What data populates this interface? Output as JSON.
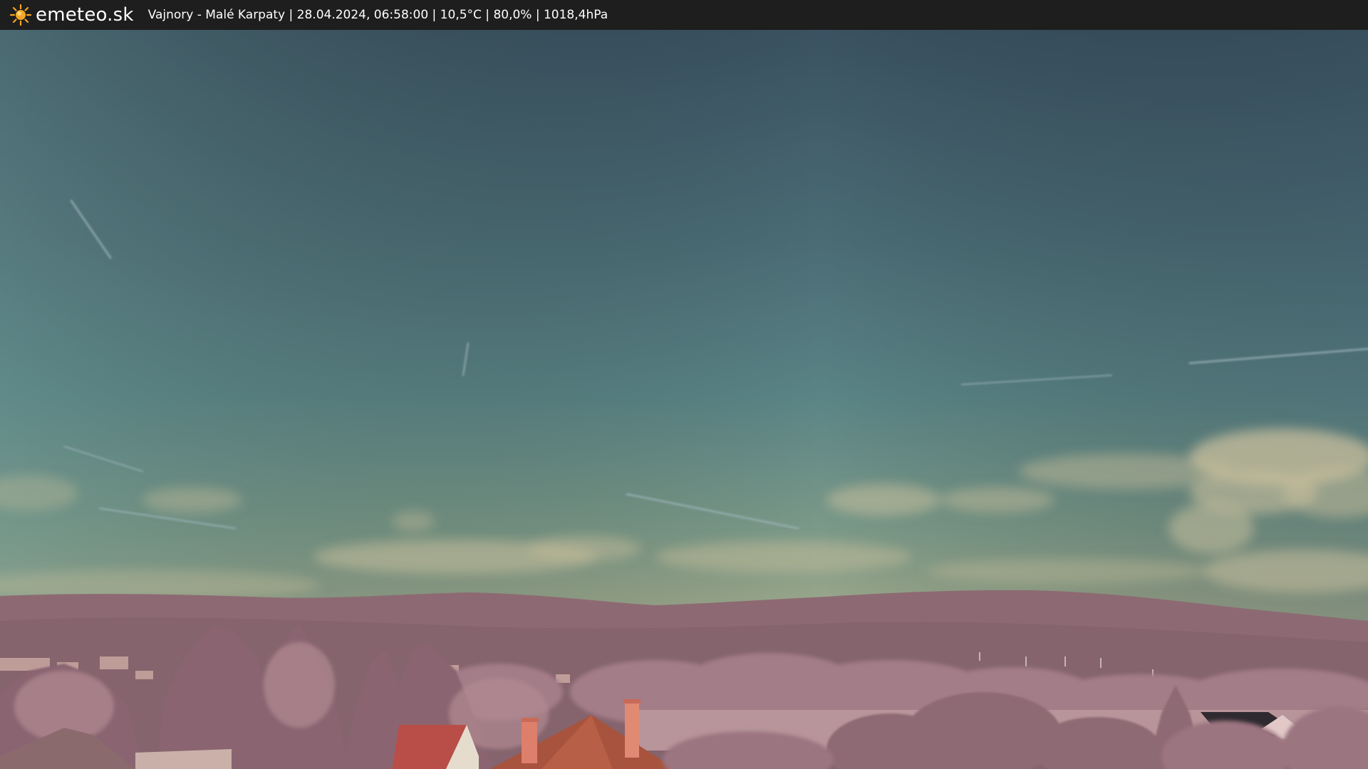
{
  "header": {
    "site_name": "emeteo.sk",
    "logo_icon": "sun-icon",
    "caption": "Vajnory - Malé Karpaty | 28.04.2024, 06:58:00 | 10,5°C | 80,0% | 1018,4hPa"
  },
  "colors": {
    "bar": "#1e1e1e",
    "sun": "#f5a623",
    "sky_top": "#3c5462",
    "sky_mid": "#567e84",
    "sky_horizon": "#8ea58e",
    "hills": "#8e6a72",
    "foliage": "#a6808a",
    "roof": "#b56a4e"
  }
}
